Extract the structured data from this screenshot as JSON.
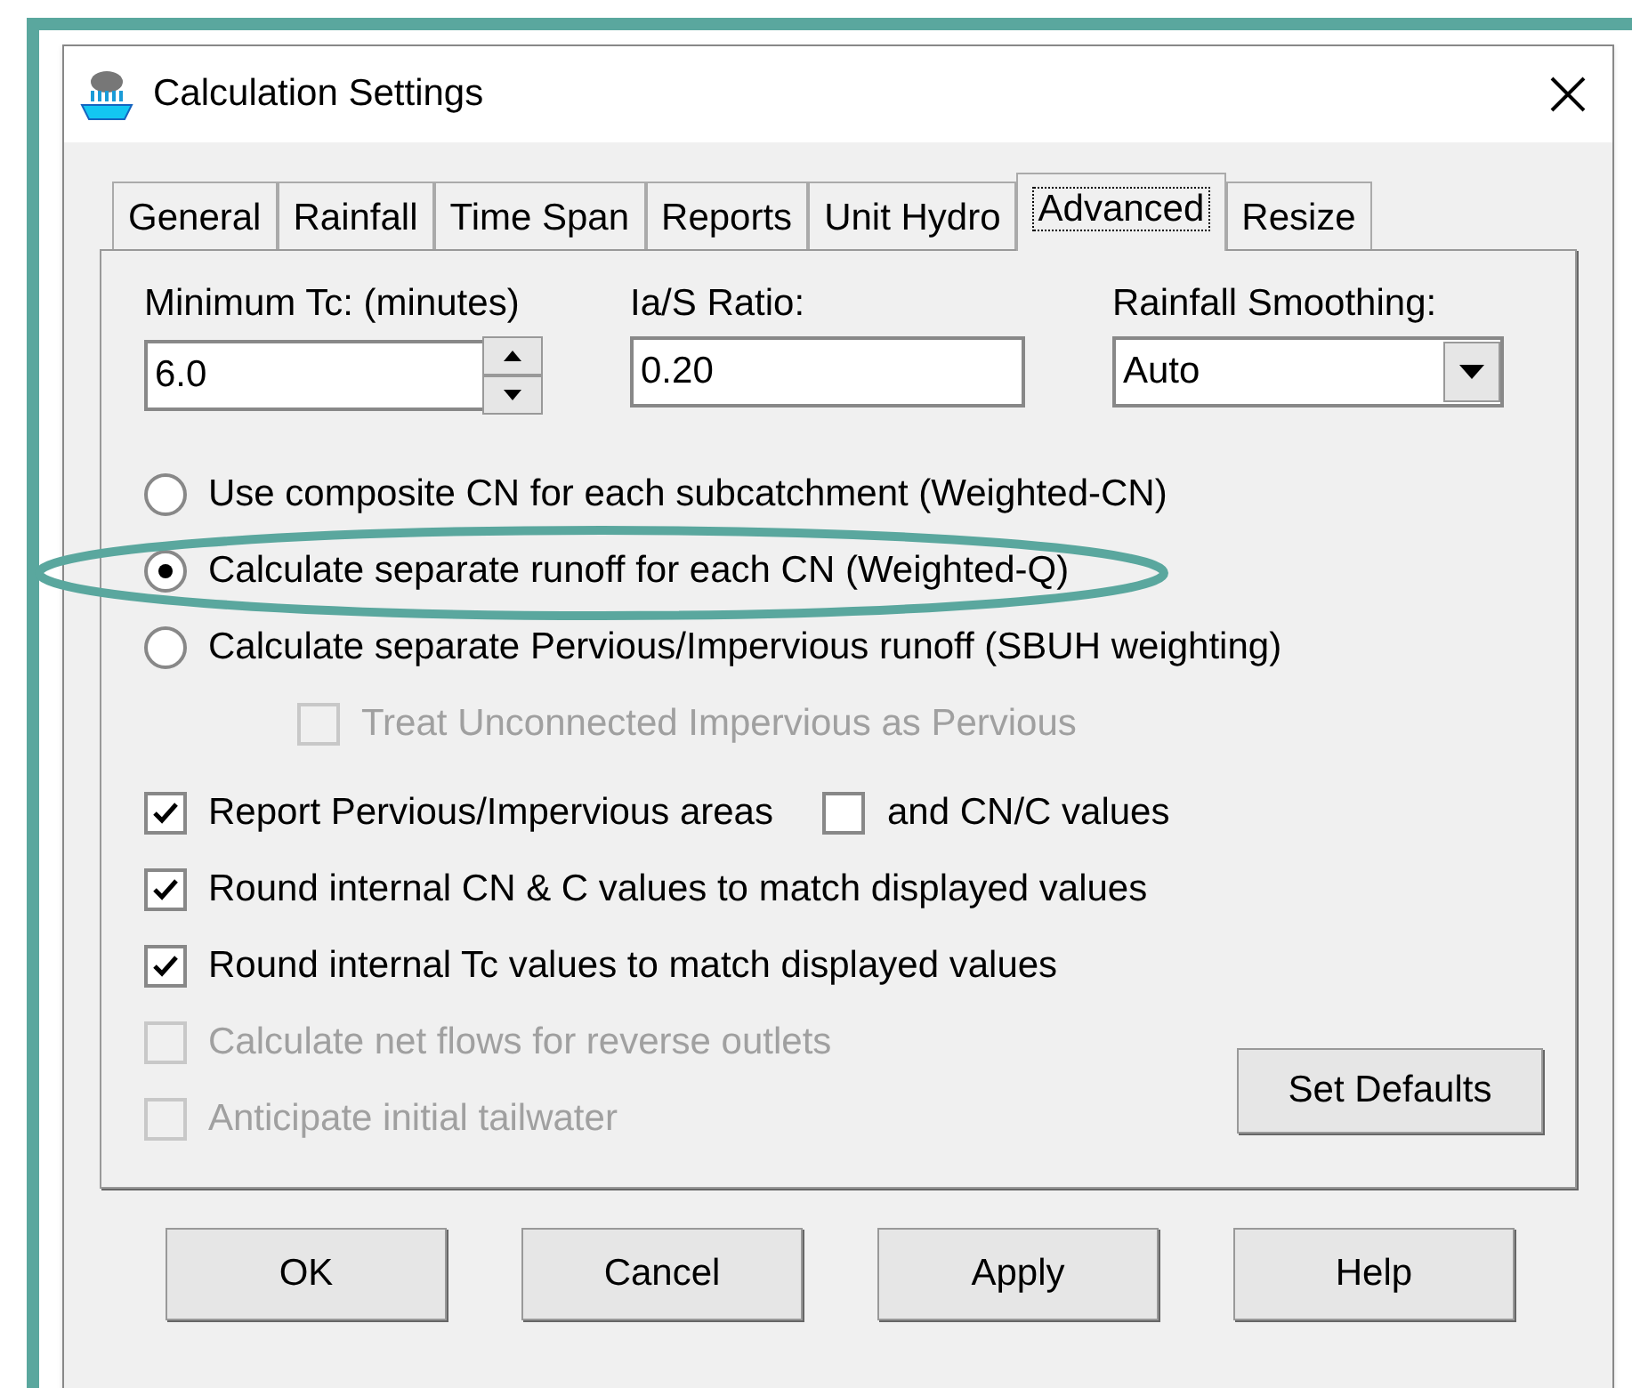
{
  "window": {
    "title": "Calculation Settings"
  },
  "tabs": [
    {
      "label": "General",
      "selected": false
    },
    {
      "label": "Rainfall",
      "selected": false
    },
    {
      "label": "Time Span",
      "selected": false
    },
    {
      "label": "Reports",
      "selected": false
    },
    {
      "label": "Unit Hydro",
      "selected": false
    },
    {
      "label": "Advanced",
      "selected": true
    },
    {
      "label": "Resize",
      "selected": false
    }
  ],
  "fields": [
    {
      "kind": "spinner",
      "label": "Minimum Tc: (minutes)",
      "value": "6.0"
    },
    {
      "kind": "text",
      "label": "Ia/S Ratio:",
      "value": "0.20"
    },
    {
      "kind": "dropdown",
      "label": "Rainfall Smoothing:",
      "value": "Auto"
    }
  ],
  "radios": [
    {
      "label": "Use composite CN for each subcatchment (Weighted-CN)",
      "selected": false
    },
    {
      "label": "Calculate separate runoff for each CN (Weighted-Q)",
      "selected": true,
      "highlighted": true
    },
    {
      "label": "Calculate separate Pervious/Impervious runoff (SBUH weighting)",
      "selected": false,
      "children": [
        {
          "label": "Treat Unconnected Impervious as Pervious",
          "checked": false,
          "disabled": true
        }
      ]
    }
  ],
  "checkboxes": [
    {
      "label": "Report Pervious/Impervious areas",
      "checked": true,
      "disabled": false,
      "extra": {
        "label": "and CN/C values",
        "checked": false,
        "disabled": false
      }
    },
    {
      "label": "Round internal CN & C values to match displayed values",
      "checked": true,
      "disabled": false
    },
    {
      "label": "Round internal Tc values to match displayed values",
      "checked": true,
      "disabled": false
    },
    {
      "label": "Calculate net flows for reverse outlets",
      "checked": false,
      "disabled": true
    },
    {
      "label": "Anticipate initial tailwater",
      "checked": false,
      "disabled": true
    }
  ],
  "set_defaults_button": "Set Defaults",
  "buttons": [
    "OK",
    "Cancel",
    "Apply",
    "Help"
  ]
}
